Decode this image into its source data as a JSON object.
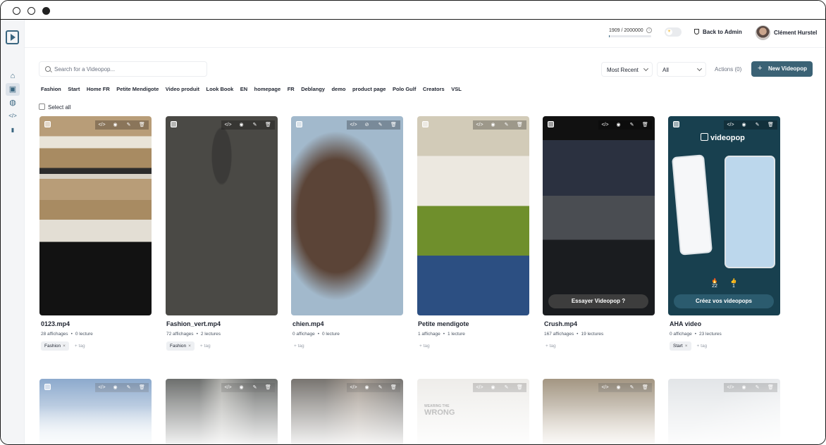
{
  "window": {
    "controls": [
      "close",
      "minimize",
      "maximize"
    ]
  },
  "sidebar": {
    "logo": "videopop-logo-icon",
    "items": [
      {
        "name": "home",
        "icon": "home-icon",
        "glyph": "⌂"
      },
      {
        "name": "videos",
        "icon": "video-camera-icon",
        "glyph": "▣",
        "active": true
      },
      {
        "name": "web",
        "icon": "globe-icon",
        "glyph": "◍"
      },
      {
        "name": "embed",
        "icon": "code-icon",
        "glyph": "</>"
      },
      {
        "name": "analytics",
        "icon": "bar-chart-icon",
        "glyph": "▮"
      }
    ]
  },
  "header": {
    "quota_text": "1909 / 2000000",
    "quota_fraction": 0.001,
    "theme_toggle_icon": "sun-icon",
    "back_to_admin": "Back to Admin",
    "user_name": "Clément Hurstel"
  },
  "toolbar": {
    "search_placeholder": "Search for a Videopop...",
    "sort_value": "Most Recent",
    "filter_value": "All",
    "actions_label": "Actions (0)",
    "new_button_plus": "+",
    "new_button_label": "New Videopop",
    "accent_color": "#3b6275"
  },
  "tags": [
    "Fashion",
    "Start",
    "Home FR",
    "Petite Mendigote",
    "Video produit",
    "Look Book",
    "EN",
    "homepage",
    "FR",
    "Deblangy",
    "demo",
    "product page",
    "Polo Gulf",
    "Creators",
    "VSL"
  ],
  "select_all_label": "Select all",
  "card_tools": [
    "</>",
    "◉",
    "✎",
    "🗑"
  ],
  "card_tools_hidden": [
    "</>",
    "⊘",
    "✎",
    "🗑"
  ],
  "videos": [
    {
      "title": "0123.mp4",
      "views": "28 affichages",
      "plays": "0 lecture",
      "tags": [
        "Fashion"
      ],
      "add_tag": "+ tag"
    },
    {
      "title": "Fashion_vert.mp4",
      "views": "72 affichages",
      "plays": "2 lectures",
      "tags": [
        "Fashion"
      ],
      "add_tag": "+ tag"
    },
    {
      "title": "chien.mp4",
      "views": "0 affichage",
      "plays": "0 lecture",
      "tags": [],
      "add_tag": "+ tag"
    },
    {
      "title": "Petite mendigote",
      "views": "1 affichage",
      "plays": "1 lecture",
      "tags": [],
      "add_tag": "+ tag"
    },
    {
      "title": "Crush.mp4",
      "views": "167 affichages",
      "plays": "19 lectures",
      "tags": [],
      "add_tag": "+ tag",
      "cta": "Essayer Videopop ?"
    },
    {
      "title": "AHA video",
      "views": "0 affichage",
      "plays": "23 lectures",
      "tags": [
        "Start"
      ],
      "add_tag": "+ tag",
      "cta": "Créez vos videopops",
      "brand": "videopop",
      "reactions": [
        {
          "emoji": "🔥",
          "count": "22"
        },
        {
          "emoji": "👍",
          "count": "1"
        }
      ]
    }
  ],
  "row2_overlay": {
    "line1": "WEARING THE",
    "line2": "WRONG"
  }
}
